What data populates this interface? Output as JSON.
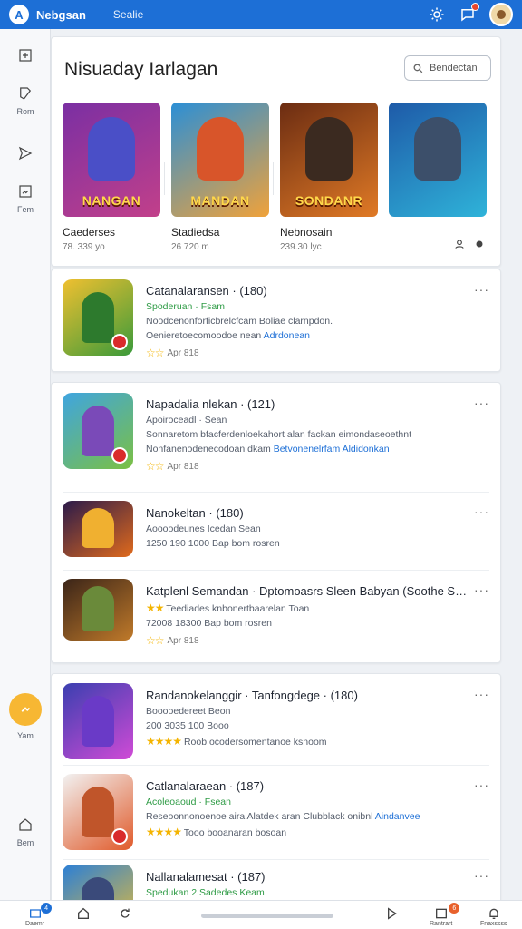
{
  "header": {
    "logo_letter": "A",
    "title": "Nebgsan",
    "tab": "Sealie"
  },
  "sidebar": {
    "items": [
      {
        "icon": "plus-square-icon",
        "label": ""
      },
      {
        "icon": "tag-icon",
        "label": "Rom"
      },
      {
        "icon": "send-icon",
        "label": ""
      },
      {
        "icon": "image-icon",
        "label": "Fem"
      },
      {
        "icon": "active-app-icon",
        "label": "Yam"
      },
      {
        "icon": "home-icon",
        "label": "Bem"
      }
    ]
  },
  "featured": {
    "title": "Nisuaday Iarlagan",
    "button": "Bendectan",
    "tiles": [
      {
        "banner": "NANGAN",
        "name": "Caederses",
        "sub": "78. 339 yo",
        "color1": "#7a2fa3",
        "color2": "#c2408a"
      },
      {
        "banner": "MANDAN",
        "name": "Stadiedsa",
        "sub": "26 720 m",
        "color1": "#2b8fd6",
        "color2": "#f0a23a"
      },
      {
        "banner": "SONDANR",
        "name": "Nebnosain",
        "sub": "239.30 lyc",
        "color1": "#6b2c12",
        "color2": "#e07a26"
      },
      {
        "banner": "",
        "name": "",
        "sub": "",
        "color1": "#1e5aa8",
        "color2": "#2fb3d9"
      }
    ]
  },
  "games": [
    {
      "title": "Catanalaransen · (180)",
      "line1": "Spoderuan · Fsam",
      "line2": "Noodcenonforficbrelcfcam Boliae clarnpdon.",
      "line3": "Oenieretoecomoodoe nean",
      "line3_link": "Adrdonean",
      "meta": "Apr 818",
      "rating": "",
      "icon_c1": "#f0c030",
      "icon_c2": "#3a9a3a"
    },
    {
      "title": "Napadalia nlekan · (121)",
      "line1": "Apoiroceadl · Sean",
      "line2": "Sonnaretom bfacferdenloekahort alan fackan eimondaseoethnt",
      "line3": "Nonfanenodenecodoan dkam",
      "line3_link": "Betvonenelrfam Aldidonkan",
      "meta": "Apr 818",
      "rating": "",
      "icon_c1": "#3fa5e0",
      "icon_c2": "#7bc043"
    },
    {
      "title": "Nanokeltan · (180)",
      "line1": "Aoooodeunes Icedan  Sean",
      "line2": "1250 190 1000 Bap bom rosren",
      "line3": "",
      "line3_link": "",
      "meta": "",
      "rating": "",
      "icon_c1": "#2a1a4a",
      "icon_c2": "#e06a1c"
    },
    {
      "title": "Katplenl Semandan · Dptomoasrs Sleen Babyan (Soothe Satep)",
      "line1": "Teediades knbonertbaarelan Toan",
      "line2": "72008 18300 Bap bom rosren",
      "line3": "",
      "line3_link": "",
      "meta": "Apr 818",
      "rating": "★★",
      "icon_c1": "#3a2418",
      "icon_c2": "#c07a2a"
    },
    {
      "title": "Randanokelanggir · Tanfongdege · (180)",
      "line1": "Booooedereet Beon",
      "line2": "200 3035 100 Booo",
      "line3": "Roob ocodersomentanoe ksnoom",
      "line3_link": "",
      "meta": "",
      "rating": "★★★★",
      "icon_c1": "#3a3fb0",
      "icon_c2": "#d04bd6"
    },
    {
      "title": "Catlanalaraean · (187)",
      "line1": "Acoleoaoud · Fsean",
      "line2": "Reseoonnonoenoe aira Alatdek aran Clubblack onibnl",
      "line3": "Tooo booanaran bosoan",
      "line3_link": "Aindanvee",
      "meta": "",
      "rating": "★★★★",
      "icon_c1": "#f2f2f2",
      "icon_c2": "#e05a2a"
    },
    {
      "title": "Nallanalamesat · (187)",
      "line1": "Spedukan 2 Sadedes Keam",
      "line2": "",
      "line3": "",
      "line3_link": "",
      "meta": "",
      "rating": "",
      "icon_c1": "#2b7fd6",
      "icon_c2": "#f0c030"
    }
  ],
  "bottombar": {
    "left_label": "Daemr",
    "badge_left": "4",
    "badge_right": "6",
    "right1_label": "Rantrart",
    "right2_label": "Fnaxssss"
  }
}
